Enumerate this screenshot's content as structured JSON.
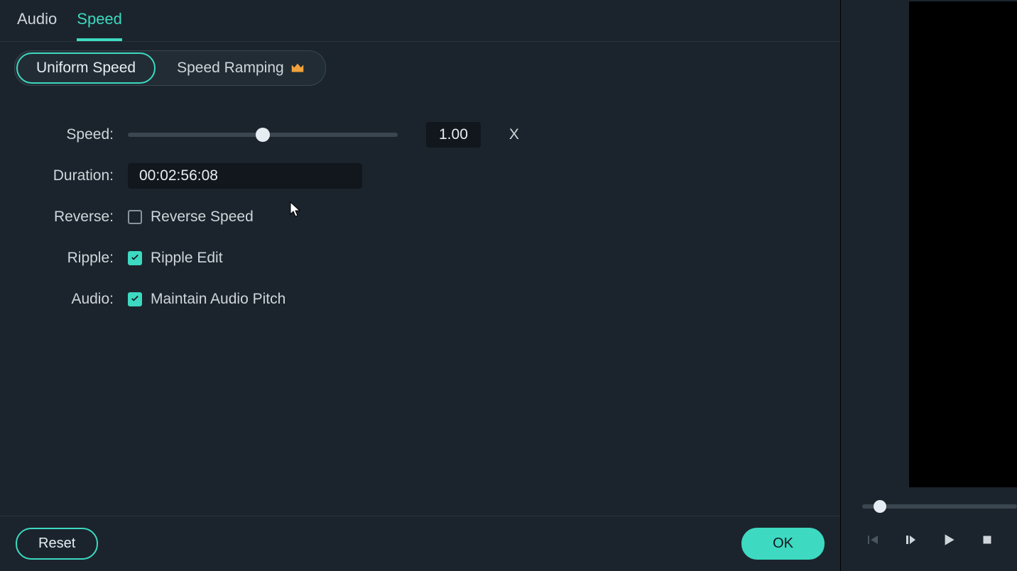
{
  "tabs": {
    "audio": "Audio",
    "speed": "Speed"
  },
  "mode": {
    "uniform": "Uniform Speed",
    "ramping": "Speed Ramping"
  },
  "labels": {
    "speed": "Speed",
    "duration": "Duration",
    "reverse": "Reverse",
    "ripple": "Ripple",
    "audio": "Audio"
  },
  "speed": {
    "value": "1.00",
    "unit": "X",
    "slider_percent": 50
  },
  "duration": {
    "value": "00:02:56:08"
  },
  "checks": {
    "reverse": {
      "label": "Reverse Speed",
      "checked": false
    },
    "ripple": {
      "label": "Ripple Edit",
      "checked": true
    },
    "audio": {
      "label": "Maintain Audio Pitch",
      "checked": true
    }
  },
  "footer": {
    "reset": "Reset",
    "ok": "OK"
  }
}
